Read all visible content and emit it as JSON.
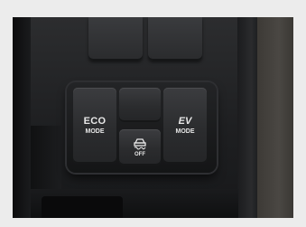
{
  "photo": {
    "subject": "vehicle center console switch panel"
  },
  "buttons": {
    "eco": {
      "line1": "ECO",
      "line2": "MODE"
    },
    "traction": {
      "label": "OFF",
      "icon": "traction-control-skid-icon"
    },
    "ev": {
      "line1": "EV",
      "line2": "MODE"
    }
  },
  "colors": {
    "button_text": "#e8e8e8",
    "console": "#1e1f21",
    "frame": "#ececec"
  }
}
